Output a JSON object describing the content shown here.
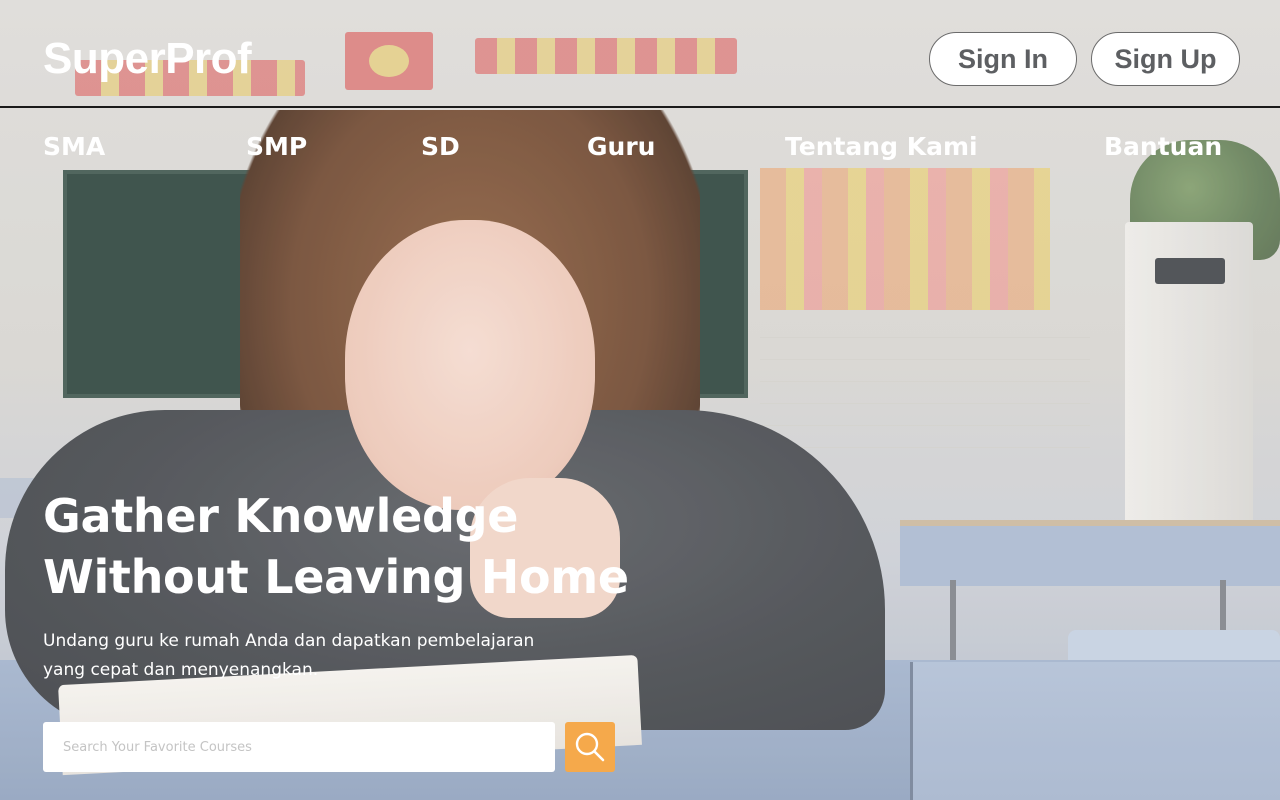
{
  "header": {
    "logo": "SuperProf",
    "sign_in_label": "Sign In",
    "sign_up_label": "Sign Up"
  },
  "nav": {
    "items": [
      {
        "label": "SMA"
      },
      {
        "label": "SMP"
      },
      {
        "label": "SD"
      },
      {
        "label": "Guru"
      },
      {
        "label": "Tentang Kami"
      },
      {
        "label": "Bantuan"
      }
    ]
  },
  "hero": {
    "title_line1": "Gather Knowledge",
    "title_line2": "Without Leaving Home",
    "subtitle_line1": "Undang guru ke rumah Anda dan dapatkan pembelajaran",
    "subtitle_line2": "yang cepat dan menyenangkan.",
    "background_icon": "classroom-photo"
  },
  "search": {
    "placeholder": "Search Your Favorite Courses",
    "value": "",
    "button_icon": "search-icon"
  },
  "colors": {
    "accent": "#f5a94b",
    "text_on_image": "#ffffff",
    "button_text": "#5d5f62",
    "divider": "#1a1a1a"
  }
}
